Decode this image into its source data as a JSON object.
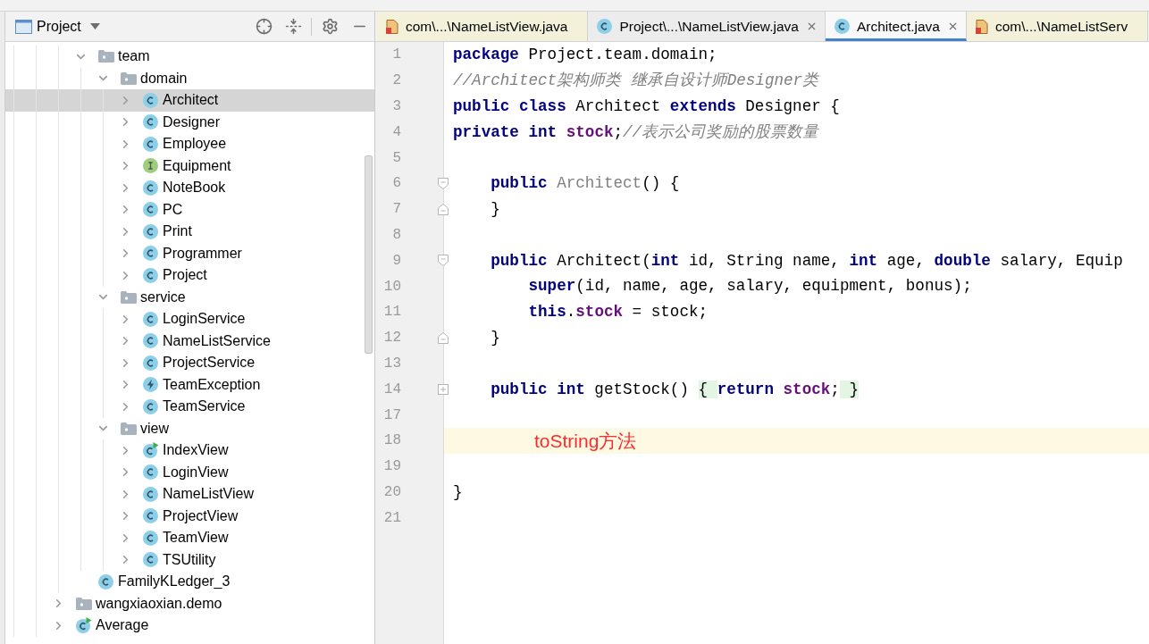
{
  "project_panel": {
    "title": "Project",
    "tree": [
      {
        "expanded": true,
        "children": [
          {
            "label": "team",
            "kind": "package",
            "expanded": true,
            "selected": false,
            "children": [
              {
                "label": "domain",
                "kind": "package",
                "expanded": true,
                "selected": false,
                "children": [
                  {
                    "label": "Architect",
                    "kind": "class",
                    "expanded": false,
                    "selected": true
                  },
                  {
                    "label": "Designer",
                    "kind": "class",
                    "expanded": false,
                    "selected": false
                  },
                  {
                    "label": "Employee",
                    "kind": "class",
                    "expanded": false,
                    "selected": false
                  },
                  {
                    "label": "Equipment",
                    "kind": "interface",
                    "expanded": false,
                    "selected": false
                  },
                  {
                    "label": "NoteBook",
                    "kind": "class",
                    "expanded": false,
                    "selected": false
                  },
                  {
                    "label": "PC",
                    "kind": "class",
                    "expanded": false,
                    "selected": false
                  },
                  {
                    "label": "Print",
                    "kind": "class",
                    "expanded": false,
                    "selected": false
                  },
                  {
                    "label": "Programmer",
                    "kind": "class",
                    "expanded": false,
                    "selected": false
                  },
                  {
                    "label": "Project",
                    "kind": "class",
                    "expanded": false,
                    "selected": false
                  }
                ]
              },
              {
                "label": "service",
                "kind": "package",
                "expanded": true,
                "selected": false,
                "children": [
                  {
                    "label": "LoginService",
                    "kind": "class",
                    "expanded": false,
                    "selected": false
                  },
                  {
                    "label": "NameListService",
                    "kind": "class",
                    "expanded": false,
                    "selected": false
                  },
                  {
                    "label": "ProjectService",
                    "kind": "class",
                    "expanded": false,
                    "selected": false
                  },
                  {
                    "label": "TeamException",
                    "kind": "exception",
                    "expanded": false,
                    "selected": false
                  },
                  {
                    "label": "TeamService",
                    "kind": "class",
                    "expanded": false,
                    "selected": false
                  }
                ]
              },
              {
                "label": "view",
                "kind": "package",
                "expanded": true,
                "selected": false,
                "children": [
                  {
                    "label": "IndexView",
                    "kind": "runnable_class",
                    "expanded": false,
                    "selected": false
                  },
                  {
                    "label": "LoginView",
                    "kind": "class",
                    "expanded": false,
                    "selected": false
                  },
                  {
                    "label": "NameListView",
                    "kind": "class",
                    "expanded": false,
                    "selected": false
                  },
                  {
                    "label": "ProjectView",
                    "kind": "class",
                    "expanded": false,
                    "selected": false
                  },
                  {
                    "label": "TeamView",
                    "kind": "class",
                    "expanded": false,
                    "selected": false
                  },
                  {
                    "label": "TSUtility",
                    "kind": "class",
                    "expanded": false,
                    "selected": false
                  }
                ]
              }
            ]
          },
          {
            "label": "FamilyKLedger_3",
            "kind": "class",
            "selected": false
          }
        ]
      },
      {
        "label": "wangxiaoxian.demo",
        "kind": "package",
        "expanded": false,
        "selected": false
      },
      {
        "label": "Average",
        "kind": "runnable_class",
        "expanded": false,
        "selected": false
      }
    ]
  },
  "editor": {
    "tabs": [
      {
        "label": "com\\...\\NameListView.java",
        "kind": "external",
        "selected": false,
        "closable": false
      },
      {
        "label": "Project\\...\\NameListView.java",
        "kind": "class",
        "selected": false,
        "closable": true
      },
      {
        "label": "Architect.java",
        "kind": "class",
        "selected": true,
        "closable": true
      },
      {
        "label": "com\\...\\NameListServ",
        "kind": "external",
        "selected": false,
        "closable": false
      }
    ],
    "lines": [
      {
        "number": "1",
        "kind": "plain",
        "current": false,
        "tokens": [
          {
            "kind": "keyword",
            "text": "package"
          },
          {
            "kind": "plain",
            "text": " Project.team.domain;"
          }
        ]
      },
      {
        "number": "2",
        "kind": "plain",
        "current": false,
        "tokens": [
          {
            "kind": "comment",
            "text": "//Architect架构师类 继承自设计师Designer类"
          }
        ]
      },
      {
        "number": "3",
        "kind": "plain",
        "current": false,
        "tokens": [
          {
            "kind": "keyword",
            "text": "public class"
          },
          {
            "kind": "plain",
            "text": " Architect "
          },
          {
            "kind": "keyword",
            "text": "extends"
          },
          {
            "kind": "plain",
            "text": " Designer {"
          }
        ]
      },
      {
        "number": "4",
        "kind": "plain",
        "current": false,
        "tokens": [
          {
            "kind": "keyword",
            "text": "private int "
          },
          {
            "kind": "field",
            "text": "stock"
          },
          {
            "kind": "plain",
            "text": ";"
          },
          {
            "kind": "comment",
            "text": "//表示公司奖励的股票数量"
          }
        ]
      },
      {
        "number": "5",
        "kind": "plain",
        "current": false
      },
      {
        "number": "6",
        "kind": "fold_start",
        "current": false,
        "tokens": [
          {
            "kind": "keyword",
            "text": "    public "
          },
          {
            "kind": "unused",
            "text": "Architect"
          },
          {
            "kind": "plain",
            "text": "() {"
          }
        ]
      },
      {
        "number": "7",
        "kind": "fold_end",
        "current": false,
        "tokens": [
          {
            "kind": "plain",
            "text": "    }"
          }
        ]
      },
      {
        "number": "8",
        "kind": "plain",
        "current": false
      },
      {
        "number": "9",
        "kind": "fold_start",
        "current": false,
        "tokens": [
          {
            "kind": "keyword",
            "text": "    public"
          },
          {
            "kind": "plain",
            "text": " Architect("
          },
          {
            "kind": "keyword",
            "text": "int"
          },
          {
            "kind": "plain",
            "text": " id, String name, "
          },
          {
            "kind": "keyword",
            "text": "int"
          },
          {
            "kind": "plain",
            "text": " age, "
          },
          {
            "kind": "keyword",
            "text": "double"
          },
          {
            "kind": "plain",
            "text": " salary, Equip"
          }
        ]
      },
      {
        "number": "10",
        "kind": "plain",
        "current": false,
        "tokens": [
          {
            "kind": "keyword",
            "text": "        super"
          },
          {
            "kind": "plain",
            "text": "(id, name, age, salary, equipment, bonus);"
          }
        ]
      },
      {
        "number": "11",
        "kind": "plain",
        "current": false,
        "tokens": [
          {
            "kind": "keyword",
            "text": "        this"
          },
          {
            "kind": "plain",
            "text": "."
          },
          {
            "kind": "field",
            "text": "stock"
          },
          {
            "kind": "plain",
            "text": " = stock;"
          }
        ]
      },
      {
        "number": "12",
        "kind": "fold_end",
        "current": false,
        "tokens": [
          {
            "kind": "plain",
            "text": "    }"
          }
        ]
      },
      {
        "number": "13",
        "kind": "plain",
        "current": false
      },
      {
        "number": "14",
        "kind": "fold_collapsed",
        "current": false,
        "tokens": [
          {
            "kind": "keyword",
            "text": "    public int"
          },
          {
            "kind": "plain",
            "text": " getStock() "
          },
          {
            "kind": "folded",
            "text": "{ "
          },
          {
            "kind": "keyword",
            "text": "return "
          },
          {
            "kind": "field",
            "text": "stock"
          },
          {
            "kind": "plain",
            "text": ";"
          },
          {
            "kind": "folded",
            "text": " }"
          }
        ]
      },
      {
        "number": "17",
        "kind": "plain",
        "current": false
      },
      {
        "number": "18",
        "kind": "plain",
        "current": true,
        "tokens": [
          {
            "kind": "annotation",
            "text": "toString方法"
          }
        ]
      },
      {
        "number": "19",
        "kind": "plain",
        "current": false
      },
      {
        "number": "20",
        "kind": "plain",
        "current": false,
        "tokens": [
          {
            "kind": "plain",
            "text": "}"
          }
        ]
      },
      {
        "number": "21",
        "kind": "plain",
        "current": false
      }
    ]
  }
}
